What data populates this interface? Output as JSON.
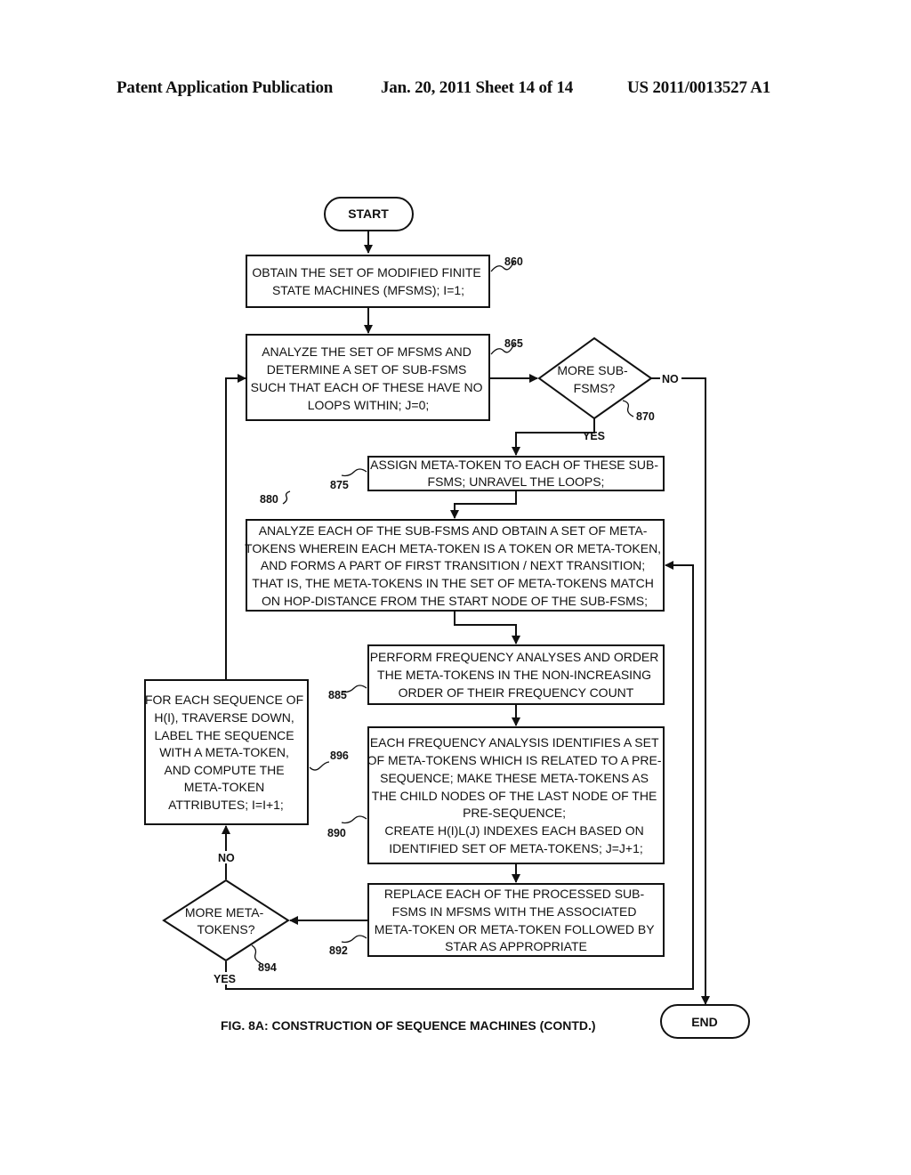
{
  "header": {
    "publication": "Patent Application Publication",
    "date_sheet": "Jan. 20, 2011  Sheet 14 of 14",
    "number": "US 2011/0013527 A1"
  },
  "diagram": {
    "start": "START",
    "end": "END",
    "steps": {
      "s860": {
        "ref": "860",
        "lines": [
          "OBTAIN THE SET OF MODIFIED FINITE",
          "STATE MACHINES (MFSMS); I=1;"
        ]
      },
      "s865": {
        "ref": "865",
        "lines": [
          "ANALYZE THE SET OF MFSMS AND",
          "DETERMINE A SET OF SUB-FSMS",
          "SUCH THAT EACH OF THESE HAVE NO",
          "LOOPS WITHIN; J=0;"
        ]
      },
      "d870": {
        "ref": "870",
        "lines": [
          "MORE SUB-",
          "FSMS?"
        ],
        "yes": "YES",
        "no": "NO"
      },
      "s875": {
        "ref": "875",
        "lines": [
          "ASSIGN META-TOKEN TO EACH OF THESE SUB-",
          "FSMS; UNRAVEL THE LOOPS;"
        ]
      },
      "s880": {
        "ref": "880",
        "lines": [
          "ANALYZE EACH OF THE SUB-FSMS AND OBTAIN A SET OF META-",
          "TOKENS WHEREIN EACH META-TOKEN IS A TOKEN OR META-TOKEN,",
          "AND FORMS A PART OF FIRST TRANSITION / NEXT TRANSITION;",
          "THAT IS, THE META-TOKENS IN THE SET OF META-TOKENS MATCH",
          "ON HOP-DISTANCE FROM THE START NODE OF THE SUB-FSMS;"
        ]
      },
      "s885": {
        "ref": "885",
        "lines": [
          "PERFORM FREQUENCY ANALYSES AND ORDER",
          "THE META-TOKENS IN THE NON-INCREASING",
          "ORDER OF THEIR FREQUENCY COUNT"
        ]
      },
      "s890": {
        "ref": "890",
        "lines": [
          "EACH FREQUENCY ANALYSIS IDENTIFIES A SET",
          "OF META-TOKENS WHICH IS RELATED TO A PRE-",
          "SEQUENCE; MAKE THESE META-TOKENS AS",
          "THE CHILD NODES OF THE LAST NODE OF THE",
          "PRE-SEQUENCE;",
          "CREATE H(I)L(J) INDEXES EACH BASED ON",
          "IDENTIFIED SET OF META-TOKENS; J=J+1;"
        ]
      },
      "s892": {
        "ref": "892",
        "lines": [
          "REPLACE EACH OF THE PROCESSED SUB-",
          "FSMS IN MFSMS WITH THE ASSOCIATED",
          "META-TOKEN OR META-TOKEN FOLLOWED BY",
          "STAR AS APPROPRIATE"
        ]
      },
      "d894": {
        "ref": "894",
        "lines": [
          "MORE META-",
          "TOKENS?"
        ],
        "yes": "YES",
        "no": "NO"
      },
      "s896": {
        "ref": "896",
        "lines": [
          "FOR EACH SEQUENCE OF",
          "H(I), TRAVERSE DOWN,",
          "LABEL THE SEQUENCE",
          "WITH A META-TOKEN,",
          "AND COMPUTE THE",
          "META-TOKEN",
          "ATTRIBUTES; I=I+1;"
        ]
      }
    },
    "caption": "FIG. 8A: CONSTRUCTION OF SEQUENCE MACHINES (CONTD.)"
  }
}
